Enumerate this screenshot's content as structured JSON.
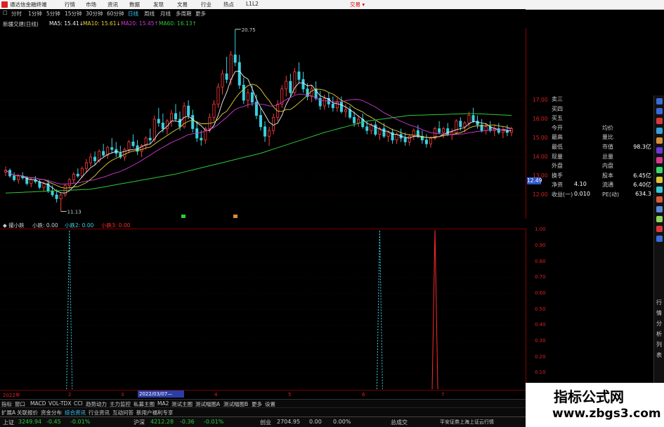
{
  "app": {
    "title": "通达信金融终端"
  },
  "menu": {
    "items": [
      "行情",
      "市场",
      "资讯",
      "数据",
      "发现",
      "文易",
      "行业",
      "热点",
      "L1L2"
    ],
    "trade": "交易 ▾"
  },
  "periods": {
    "items": [
      "分时",
      "1分钟",
      "5分钟",
      "15分钟",
      "30分钟",
      "60分钟",
      "日线",
      "周线",
      "月线",
      "多周期",
      "更多"
    ],
    "active": "日线"
  },
  "legend": {
    "stock": "新疆交建(日线)",
    "ma5": "MA5: 15.41↓",
    "ma10": "MA10: 15.61↓",
    "ma20": "MA20: 15.45↑",
    "ma60": "MA60: 16.13↑"
  },
  "colors": {
    "up": "#ff3b3b",
    "down": "#3ad0e0",
    "ma5": "#f2f2f2",
    "ma10": "#e8d23a",
    "ma20": "#d23ad6",
    "ma60": "#2fc83a",
    "axis": "#d22222"
  },
  "annotations": {
    "high": "20.75",
    "low": "11.13",
    "current": "12.49"
  },
  "chart_data": [
    {
      "type": "candlestick",
      "title": "新疆交建(日线)",
      "ylim": [
        11,
        21
      ],
      "y_ticks": [
        "17.00",
        "16.00",
        "15.00",
        "14.00",
        "13.00",
        "12.00"
      ],
      "x_ticks": [
        "2022年",
        "2",
        "3",
        "4",
        "5",
        "6",
        "7"
      ],
      "ohlc": [
        [
          13.2,
          13.5,
          13.0,
          13.3
        ],
        [
          13.3,
          13.4,
          12.9,
          13.0
        ],
        [
          13.0,
          13.2,
          12.7,
          12.8
        ],
        [
          12.8,
          13.1,
          12.6,
          13.0
        ],
        [
          13.0,
          13.2,
          12.8,
          12.9
        ],
        [
          12.9,
          13.0,
          12.5,
          12.6
        ],
        [
          12.6,
          12.9,
          12.4,
          12.8
        ],
        [
          12.8,
          13.0,
          12.6,
          12.7
        ],
        [
          12.7,
          12.8,
          12.3,
          12.4
        ],
        [
          12.4,
          12.7,
          12.2,
          12.6
        ],
        [
          12.6,
          12.8,
          12.1,
          12.2
        ],
        [
          12.2,
          12.5,
          11.9,
          12.0
        ],
        [
          12.0,
          12.3,
          11.6,
          11.8
        ],
        [
          11.8,
          12.1,
          11.13,
          12.0
        ],
        [
          12.0,
          12.6,
          11.9,
          12.5
        ],
        [
          12.5,
          12.9,
          12.3,
          12.8
        ],
        [
          12.8,
          13.2,
          12.6,
          13.1
        ],
        [
          13.1,
          13.4,
          12.9,
          13.0
        ],
        [
          13.0,
          13.5,
          12.9,
          13.4
        ],
        [
          13.4,
          13.9,
          13.2,
          13.7
        ],
        [
          13.7,
          14.2,
          13.5,
          14.0
        ],
        [
          14.0,
          14.3,
          13.6,
          13.8
        ],
        [
          13.8,
          14.4,
          13.7,
          14.3
        ],
        [
          14.3,
          14.7,
          14.0,
          14.1
        ],
        [
          14.1,
          14.6,
          13.9,
          14.5
        ],
        [
          14.5,
          15.0,
          14.2,
          14.4
        ],
        [
          14.4,
          14.8,
          14.0,
          14.2
        ],
        [
          14.2,
          14.6,
          13.9,
          14.0
        ],
        [
          14.0,
          14.5,
          13.8,
          14.4
        ],
        [
          14.4,
          14.9,
          14.2,
          14.8
        ],
        [
          14.8,
          15.2,
          14.5,
          14.6
        ],
        [
          14.6,
          14.9,
          14.1,
          14.3
        ],
        [
          14.3,
          14.7,
          14.0,
          14.6
        ],
        [
          14.6,
          15.1,
          14.4,
          15.0
        ],
        [
          15.0,
          15.5,
          14.7,
          14.9
        ],
        [
          14.9,
          16.2,
          14.8,
          16.0
        ],
        [
          16.0,
          16.6,
          15.6,
          15.8
        ],
        [
          15.8,
          16.3,
          15.3,
          15.5
        ],
        [
          15.5,
          16.0,
          15.2,
          15.9
        ],
        [
          15.9,
          16.5,
          15.6,
          16.3
        ],
        [
          16.3,
          16.8,
          15.9,
          16.0
        ],
        [
          16.0,
          16.4,
          15.4,
          15.6
        ],
        [
          15.6,
          16.9,
          15.5,
          16.7
        ],
        [
          16.7,
          17.0,
          16.0,
          16.2
        ],
        [
          16.2,
          16.5,
          15.3,
          15.5
        ],
        [
          15.5,
          15.9,
          14.8,
          15.0
        ],
        [
          15.0,
          15.4,
          14.6,
          14.9
        ],
        [
          14.9,
          15.6,
          14.7,
          15.5
        ],
        [
          15.5,
          16.3,
          15.3,
          16.1
        ],
        [
          16.1,
          17.0,
          15.9,
          16.8
        ],
        [
          16.8,
          17.9,
          16.6,
          17.7
        ],
        [
          17.7,
          18.6,
          17.3,
          18.4
        ],
        [
          18.4,
          19.3,
          17.9,
          18.1
        ],
        [
          18.1,
          19.6,
          17.8,
          19.4
        ],
        [
          19.4,
          20.75,
          18.8,
          19.0
        ],
        [
          19.0,
          19.4,
          17.6,
          17.8
        ],
        [
          17.8,
          18.2,
          16.8,
          17.0
        ],
        [
          17.0,
          17.6,
          16.6,
          17.4
        ],
        [
          17.4,
          17.8,
          16.7,
          16.9
        ],
        [
          16.9,
          17.3,
          16.0,
          16.2
        ],
        [
          16.2,
          16.6,
          15.4,
          15.6
        ],
        [
          15.6,
          15.9,
          14.8,
          15.1
        ],
        [
          15.1,
          15.6,
          14.6,
          15.4
        ],
        [
          15.4,
          16.3,
          15.2,
          16.1
        ],
        [
          16.1,
          17.0,
          15.9,
          16.8
        ],
        [
          16.8,
          17.8,
          16.6,
          17.6
        ],
        [
          17.6,
          18.3,
          17.2,
          18.0
        ],
        [
          18.0,
          18.4,
          17.2,
          17.4
        ],
        [
          17.4,
          18.7,
          17.3,
          18.5
        ],
        [
          18.5,
          19.0,
          17.9,
          18.1
        ],
        [
          18.1,
          18.5,
          17.4,
          17.6
        ],
        [
          17.6,
          17.9,
          17.0,
          17.2
        ],
        [
          17.2,
          17.8,
          16.9,
          17.6
        ],
        [
          17.6,
          18.0,
          17.0,
          17.1
        ],
        [
          17.1,
          17.5,
          16.5,
          16.7
        ],
        [
          16.7,
          17.3,
          16.5,
          17.1
        ],
        [
          17.1,
          17.4,
          16.6,
          16.8
        ],
        [
          16.8,
          17.2,
          16.4,
          16.6
        ],
        [
          16.6,
          17.1,
          16.4,
          16.9
        ],
        [
          16.9,
          17.2,
          16.3,
          16.4
        ],
        [
          16.4,
          16.8,
          16.1,
          16.5
        ],
        [
          16.5,
          16.7,
          16.0,
          16.1
        ],
        [
          16.1,
          16.4,
          15.6,
          15.8
        ],
        [
          15.8,
          16.2,
          15.6,
          16.0
        ],
        [
          16.0,
          16.3,
          15.5,
          15.6
        ],
        [
          15.6,
          15.9,
          15.2,
          15.4
        ],
        [
          15.4,
          15.8,
          15.2,
          15.7
        ],
        [
          15.7,
          15.9,
          15.1,
          15.2
        ],
        [
          15.2,
          15.6,
          14.9,
          15.5
        ],
        [
          15.5,
          15.8,
          15.0,
          15.1
        ],
        [
          15.1,
          15.4,
          14.8,
          15.3
        ],
        [
          15.3,
          15.5,
          14.7,
          14.9
        ],
        [
          14.9,
          15.3,
          14.7,
          15.2
        ],
        [
          15.2,
          15.5,
          14.8,
          15.0
        ],
        [
          15.0,
          15.3,
          14.6,
          14.8
        ],
        [
          14.8,
          15.2,
          14.6,
          15.1
        ],
        [
          15.1,
          15.5,
          14.9,
          15.4
        ],
        [
          15.4,
          15.7,
          15.0,
          15.1
        ],
        [
          15.1,
          15.4,
          14.7,
          14.9
        ],
        [
          14.9,
          15.2,
          14.5,
          14.7
        ],
        [
          14.7,
          15.1,
          14.5,
          15.0
        ],
        [
          15.0,
          15.6,
          14.9,
          15.5
        ],
        [
          15.5,
          15.9,
          15.2,
          15.3
        ],
        [
          15.3,
          15.6,
          15.0,
          15.5
        ],
        [
          15.5,
          15.8,
          15.1,
          15.2
        ],
        [
          15.2,
          15.5,
          14.9,
          15.3
        ],
        [
          15.3,
          16.0,
          15.2,
          15.9
        ],
        [
          15.9,
          16.1,
          15.4,
          15.6
        ],
        [
          15.6,
          15.9,
          15.3,
          15.8
        ],
        [
          15.8,
          16.4,
          15.6,
          16.2
        ],
        [
          16.2,
          16.6,
          15.8,
          15.9
        ],
        [
          15.9,
          16.2,
          15.5,
          15.7
        ],
        [
          15.7,
          16.0,
          15.3,
          15.4
        ],
        [
          15.4,
          15.8,
          15.2,
          15.6
        ],
        [
          15.6,
          15.9,
          15.3,
          15.4
        ],
        [
          15.4,
          15.7,
          15.1,
          15.5
        ],
        [
          15.5,
          15.8,
          15.2,
          15.3
        ],
        [
          15.3,
          15.6,
          15.0,
          15.4
        ],
        [
          15.4,
          15.7,
          15.1,
          15.3
        ],
        [
          15.3,
          15.6,
          15.1,
          15.5
        ]
      ],
      "ma60_anchor": [
        [
          0,
          12.1
        ],
        [
          20,
          12.3
        ],
        [
          40,
          13.1
        ],
        [
          60,
          14.2
        ],
        [
          75,
          15.3
        ],
        [
          85,
          15.9
        ],
        [
          95,
          16.2
        ],
        [
          110,
          16.3
        ],
        [
          119,
          16.2
        ]
      ]
    },
    {
      "type": "line",
      "title": "撮小跌",
      "ylim": [
        0,
        1
      ],
      "y_ticks": [
        "1.00",
        "0.90",
        "0.80",
        "0.70",
        "0.60",
        "0.50",
        "0.40",
        "0.30",
        "0.20",
        "0.10"
      ],
      "series": [
        {
          "name": "小跌",
          "spike_index": 15,
          "value": 1.0,
          "color": "#3ad0e0"
        },
        {
          "name": "小跌2",
          "spike_index": 88,
          "value": 1.0,
          "color": "#3ad0e0"
        },
        {
          "name": "小跌3",
          "spike_index": 101,
          "value": 1.0,
          "color": "#ff2a2a"
        }
      ]
    }
  ],
  "indicator_header": {
    "name": "◆ 撮小跌",
    "v1": "小跌: 0.00",
    "v2": "小跌2: 0.00",
    "v3": "小跌3: 0.00"
  },
  "time_axis": {
    "date": "2022/03/07—"
  },
  "sidebar": {
    "rows": [
      {
        "l": "卖三",
        "r": "",
        "v": ""
      },
      {
        "l": "买四",
        "r": "",
        "v": ""
      },
      {
        "l": "买五",
        "r": "",
        "v": ""
      },
      {
        "l": "今开",
        "r": "均价",
        "v": ""
      },
      {
        "l": "最高",
        "r": "量比",
        "v": ""
      },
      {
        "l": "最低",
        "r": "市值",
        "v": "98.3亿"
      },
      {
        "l": "现量",
        "r": "总量",
        "v": ""
      },
      {
        "l": "外盘",
        "r": "内盘",
        "v": ""
      },
      {
        "l": "换手",
        "r": "股本",
        "v": "6.45亿"
      },
      {
        "l": "净资",
        "lv": "4.10",
        "r": "流通",
        "v": "6.40亿"
      },
      {
        "l": "收益(一)",
        "lv": "0.010",
        "r": "PE(动)",
        "v": "634.3"
      }
    ]
  },
  "vertical_tabs": [
    "行",
    "情",
    "分",
    "析",
    "列",
    "表"
  ],
  "tabs1": [
    "指标",
    "窗口",
    "MACD",
    "VOL-TDX",
    "CCI",
    "趋势动力",
    "主力监控",
    "私募主图",
    "MA2",
    "测试主图",
    "测试幅图A",
    "测试幅图B",
    "更多",
    "设置"
  ],
  "tabs2": [
    "扩展A",
    "关联报价",
    "资金分布",
    "综合资讯",
    "行业资讯",
    "互动问答",
    "新用户福利专享"
  ],
  "status": {
    "sh_name": "上证",
    "sh_val": "3249.94",
    "sh_chg": "-0.45",
    "sh_pct": "-0.01%",
    "hs_name": "沪深",
    "hs_val": "4212.28",
    "hs_chg": "-0.36",
    "hs_pct": "-0.01%",
    "cy_name": "创业",
    "cy_val": "2704.95",
    "cy_chg": "0.00",
    "cy_pct": "0.00%",
    "vol_name": "总成交",
    "broker": "平安证券上海上证云行情"
  },
  "watermark": {
    "title": "指标公式网",
    "url": "www.zbgs3.com"
  }
}
